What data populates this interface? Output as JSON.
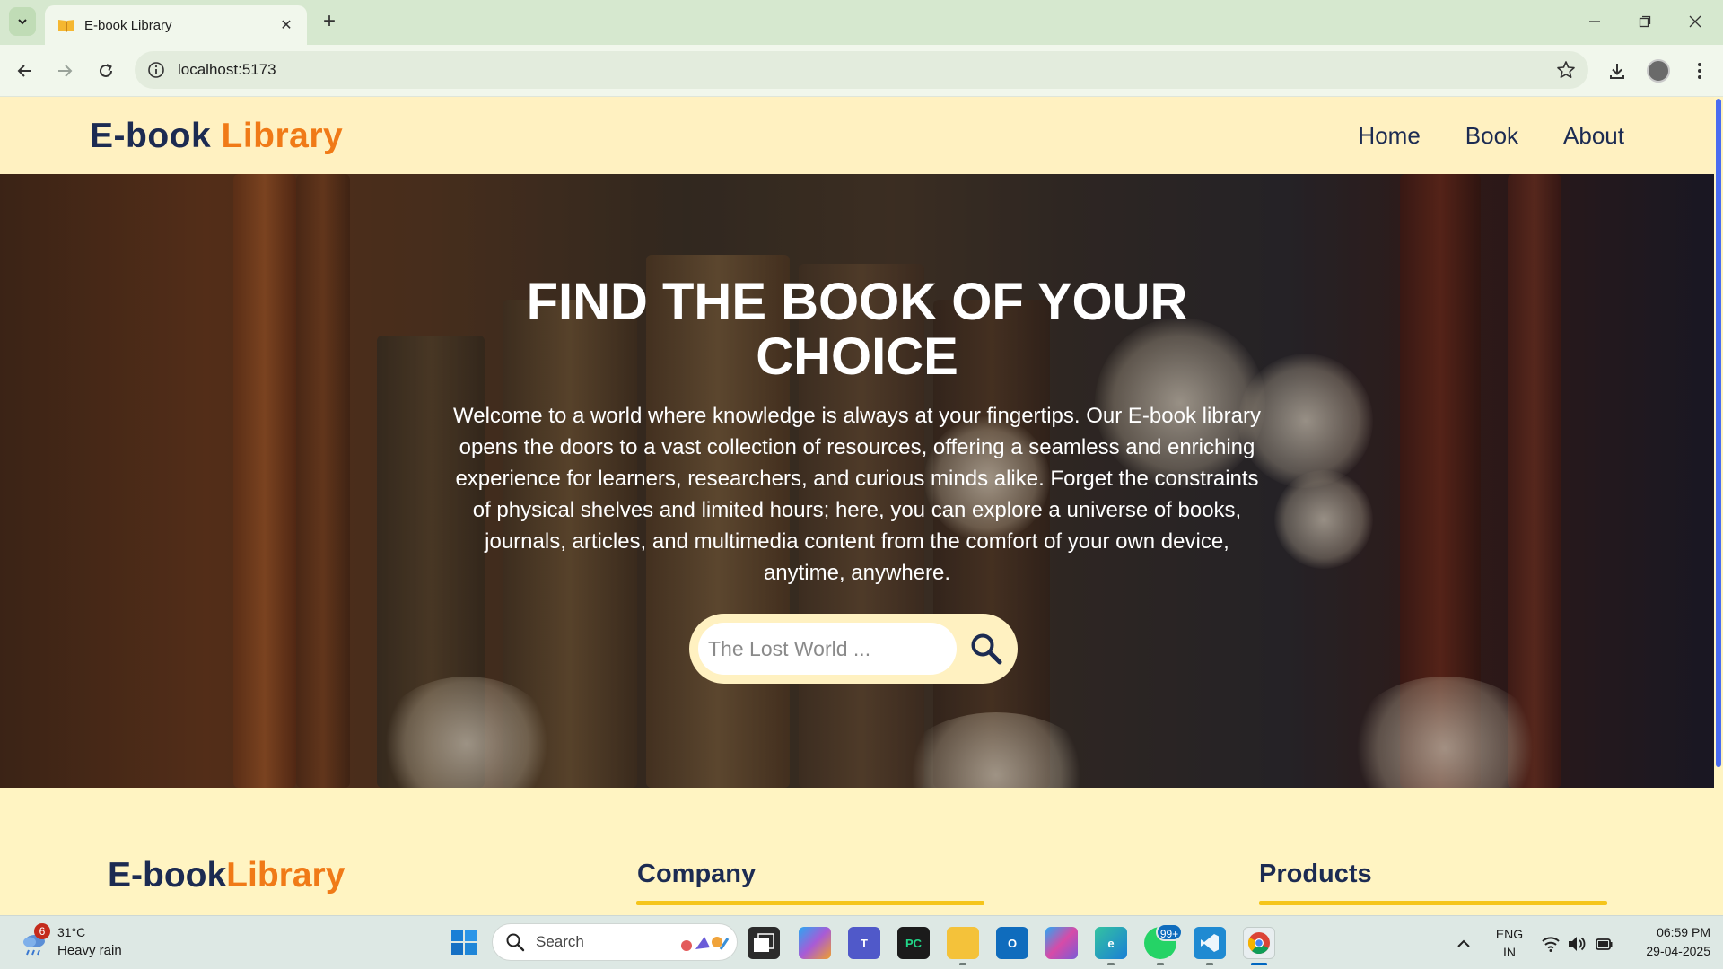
{
  "browser": {
    "tab_title": "E-book Library",
    "url": "localhost:5173",
    "icons": [
      "tab-search-icon",
      "book-favicon",
      "close-icon",
      "plus-icon",
      "minimize-icon",
      "restore-icon",
      "close-window-icon",
      "back-icon",
      "forward-icon",
      "reload-icon",
      "info-icon",
      "star-icon",
      "download-icon",
      "profile-avatar",
      "kebab-menu-icon"
    ]
  },
  "site": {
    "logo_part1": "E-book",
    "logo_part2": "Library",
    "nav": [
      {
        "label": "Home"
      },
      {
        "label": "Book"
      },
      {
        "label": "About"
      }
    ],
    "colors": {
      "brand_dark": "#1c2b52",
      "brand_orange": "#f07a17",
      "page_bg": "#fff4c2",
      "footer_underline": "#f5c51a"
    }
  },
  "hero": {
    "title_line1": "FIND THE BOOK OF YOUR",
    "title_line2": "CHOICE",
    "description": "Welcome to a world where knowledge is always at your fingertips. Our E-book library opens the doors to a vast collection of resources, offering a seamless and enriching experience for learners, researchers, and curious minds alike. Forget the constraints of physical shelves and limited hours; here, you can explore a universe of books, journals, articles, and multimedia content from the comfort of your own device, anytime, anywhere.",
    "search_placeholder": "The Lost World ..."
  },
  "footer": {
    "logo_part1": "E-book",
    "logo_part2": "Library",
    "company_heading": "Company",
    "products_heading": "Products"
  },
  "taskbar": {
    "weather_badge": "6",
    "weather_temp": "31°C",
    "weather_desc": "Heavy rain",
    "search_label": "Search",
    "whatsapp_badge": "99+",
    "lang_line1": "ENG",
    "lang_line2": "IN",
    "time": "06:59 PM",
    "date": "29-04-2025"
  }
}
